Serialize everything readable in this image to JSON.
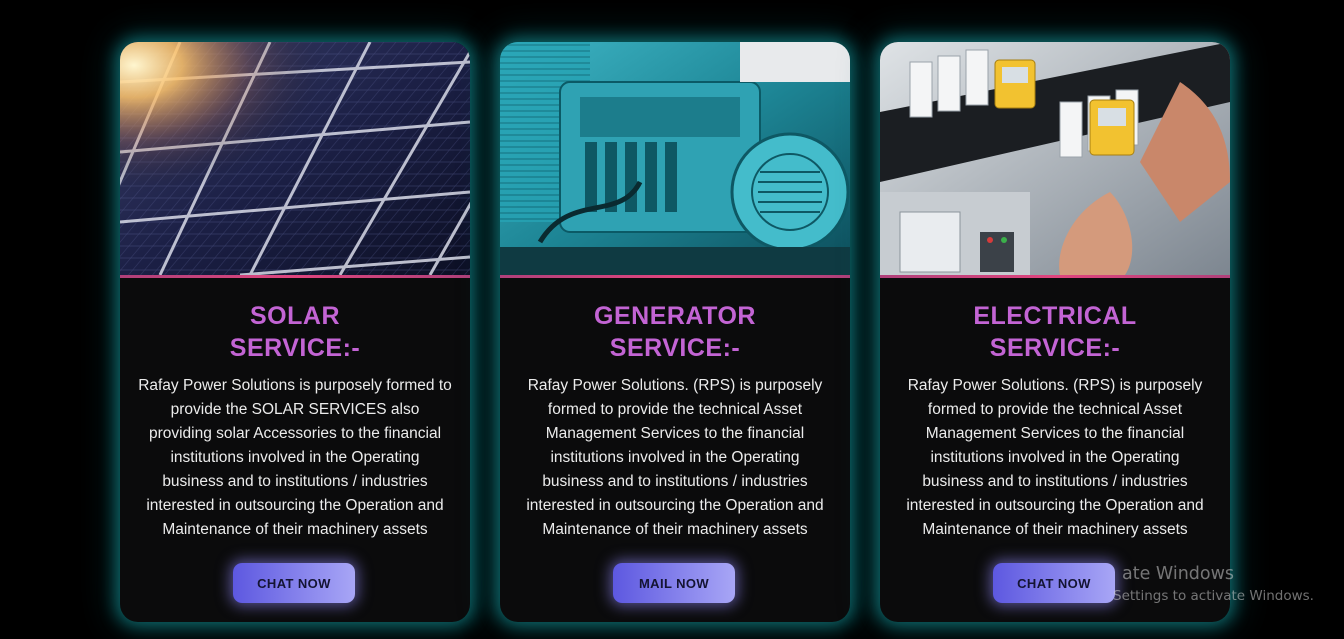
{
  "cards": [
    {
      "title_line1": "SOLAR",
      "title_line2": "SERVICE:-",
      "description": "Rafay Power Solutions is purposely formed to provide the SOLAR SERVICES also providing solar Accessories to the financial institutions involved in the Operating business and to institutions / industries interested in outsourcing the Operation and Maintenance of their machinery assets",
      "button_label": "CHAT NOW",
      "image_subject": "solar-panels-image"
    },
    {
      "title_line1": "GENERATOR",
      "title_line2": "SERVICE:-",
      "description": "Rafay Power Solutions. (RPS) is purposely formed to provide the technical Asset Management Services to the financial institutions involved in the Operating business and to institutions / industries interested in outsourcing the Operation and Maintenance of their machinery assets",
      "button_label": "MAIL NOW",
      "image_subject": "generator-engine-image"
    },
    {
      "title_line1": "ELECTRICAL",
      "title_line2": "SERVICE:-",
      "description": "Rafay Power Solutions. (RPS) is purposely formed to provide the technical Asset Management Services to the financial institutions involved in the Operating business and to institutions / industries interested in outsourcing the Operation and Maintenance of their machinery assets",
      "button_label": "CHAT NOW",
      "image_subject": "electrical-panel-image"
    }
  ],
  "watermark": {
    "line1": "ate Windows",
    "line2": "Settings to activate Windows."
  },
  "colors": {
    "background": "#000000",
    "card_glow": "#16aaaf",
    "title": "#c364d4",
    "button_start": "#5d58e0",
    "button_end": "#a8a6f6",
    "divider": "#e0457e"
  }
}
